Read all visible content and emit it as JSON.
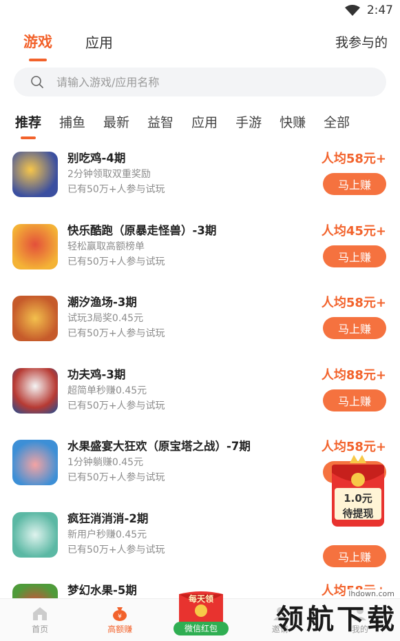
{
  "status": {
    "time": "2:47"
  },
  "top_tabs": {
    "items": [
      "游戏",
      "应用"
    ],
    "active": 0,
    "right": "我参与的"
  },
  "search": {
    "placeholder": "请输入游戏/应用名称"
  },
  "categories": [
    "推荐",
    "捕鱼",
    "最新",
    "益智",
    "应用",
    "手游",
    "快赚",
    "全部"
  ],
  "earn_label": "马上赚",
  "items": [
    {
      "title": "别吃鸡-4期",
      "desc": "2分钟领取双重奖励",
      "participants": "已有50万+人参与试玩",
      "reward": "人均58元+",
      "color": "#3b4fa0"
    },
    {
      "title": "快乐酷跑（原暴走怪兽）-3期",
      "desc": "轻松赢取高额榜单",
      "participants": "已有50万+人参与试玩",
      "reward": "人均45元+",
      "color": "#d9532c"
    },
    {
      "title": "潮汐渔场-3期",
      "desc": "试玩3局奖0.45元",
      "participants": "已有50万+人参与试玩",
      "reward": "人均58元+",
      "color": "#e89a2d"
    },
    {
      "title": "功夫鸡-3期",
      "desc": "超简单秒赚0.45元",
      "participants": "已有50万+人参与试玩",
      "reward": "人均88元+",
      "color": "#b73a33"
    },
    {
      "title": "水果盛宴大狂欢（原宝塔之战）-7期",
      "desc": "1分钟躺赚0.45元",
      "participants": "已有50万+人参与试玩",
      "reward": "人均58元+",
      "color": "#3d8fd6"
    },
    {
      "title": "疯狂消消消-2期",
      "desc": "新用户秒赚0.45元",
      "participants": "已有50万+人参与试玩",
      "reward": "",
      "color": "#5bb8a4"
    },
    {
      "title": "梦幻水果-5期",
      "desc": "",
      "participants": "",
      "reward": "人均58元+",
      "color": "#4f9b3a"
    }
  ],
  "redpack": {
    "amount": "1.0元",
    "label": "待提现"
  },
  "wechat_pack": {
    "top": "每天领",
    "label": "微信红包"
  },
  "nav": [
    {
      "label": "首页",
      "icon": "home-icon"
    },
    {
      "label": "高额赚",
      "icon": "money-bag-icon"
    },
    {
      "label": "",
      "icon": "wechat-redpack-icon"
    },
    {
      "label": "邀请",
      "icon": "user-icon"
    },
    {
      "label": "我的",
      "icon": "profile-icon"
    }
  ],
  "watermark": {
    "text": "领航下载",
    "domain": "lhdown.com"
  }
}
